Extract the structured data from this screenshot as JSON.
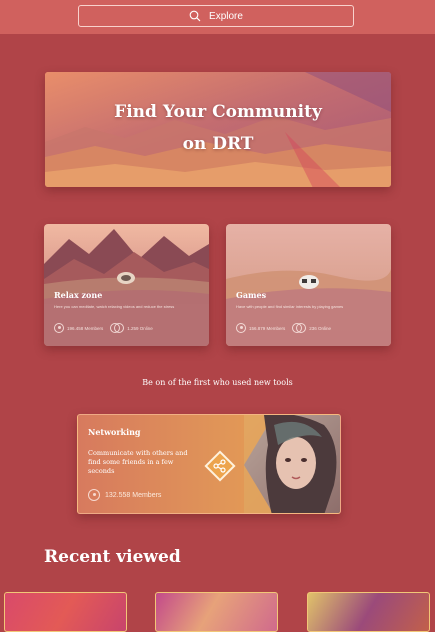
{
  "search": {
    "label": "Explore",
    "icon": "search-icon"
  },
  "hero": {
    "title_line1": "Find Your Community",
    "title_line2": "on DRT"
  },
  "communities": [
    {
      "title": "Relax zone",
      "description": "Here you can meditate, watch relaxing videos and reduce the stress",
      "members": "196.458 Members",
      "online": "1.259 Online"
    },
    {
      "title": "Games",
      "description": "Have with people and find similar interests by playing games",
      "members": "156.879 Members",
      "online": "236 Online"
    }
  ],
  "tagline": "Be on of the first who used new tools",
  "featured": {
    "title": "Networking",
    "description": "Communicate with others and find some friends in a few seconds",
    "members": "132.558 Members",
    "icon": "share-icon"
  },
  "recent": {
    "title": "Recent viewed"
  },
  "colors": {
    "background": "#b04448",
    "topbar": "#d0615e",
    "accent_orange": "#eba44e",
    "thumb_border": "#f2c777"
  }
}
